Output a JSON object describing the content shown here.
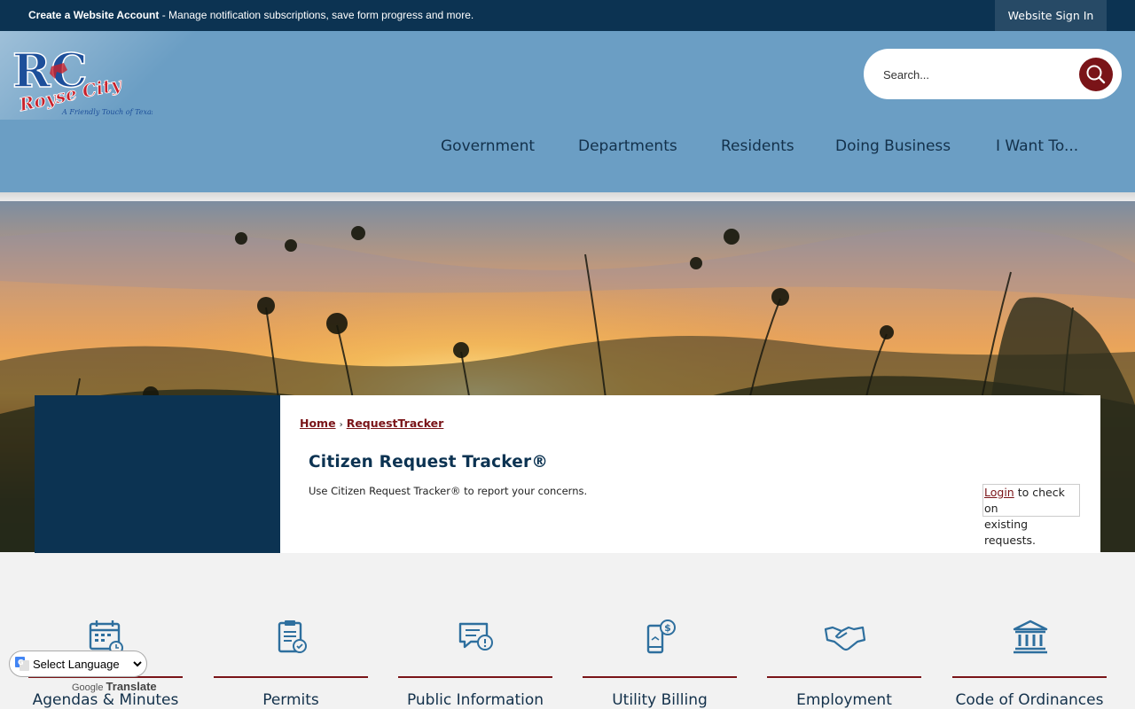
{
  "topbar": {
    "account_link": "Create a Website Account",
    "account_message": " - Manage notification subscriptions, save form progress and more.",
    "signin_label": "Website Sign In"
  },
  "header": {
    "logo_text": "RC Royse City",
    "logo_tagline": "A Friendly Touch of Texas",
    "search_placeholder": "Search...",
    "nav": [
      "Government",
      "Departments",
      "Residents",
      "Doing Business",
      "I Want To..."
    ]
  },
  "breadcrumb": {
    "home": "Home",
    "sep": "›",
    "current": "RequestTracker"
  },
  "page": {
    "title": "Citizen Request Tracker®",
    "intro": "Use Citizen Request Tracker® to report your concerns.",
    "login_link": "Login",
    "login_text_1": " to check on",
    "login_text_2": "existing requests."
  },
  "quick_links": [
    {
      "label": "Agendas & Minutes",
      "icon": "calendar-clock-icon"
    },
    {
      "label": "Permits",
      "icon": "clipboard-check-icon"
    },
    {
      "label": "Public Information",
      "icon": "chat-alert-icon"
    },
    {
      "label": "Utility Billing",
      "icon": "phone-dollar-icon"
    },
    {
      "label": "Employment",
      "icon": "handshake-icon"
    },
    {
      "label": "Code of Ordinances",
      "icon": "courthouse-icon"
    }
  ],
  "translate": {
    "select_label": "Select Language",
    "powered_google": "Google",
    "powered_translate": "Translate"
  },
  "colors": {
    "navy": "#0c3352",
    "header_blue": "#6b9ec4",
    "maroon": "#7a1418",
    "icon_blue": "#2e6f9e"
  }
}
